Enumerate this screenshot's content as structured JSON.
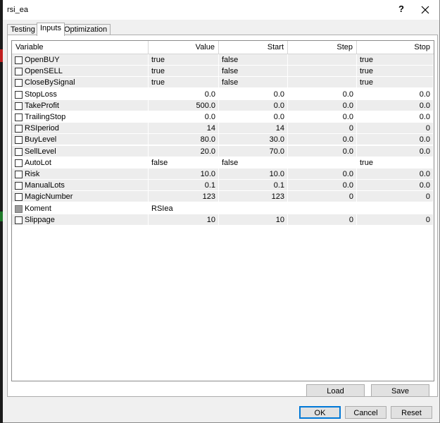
{
  "window": {
    "title": "rsi_ea",
    "help_glyph": "?"
  },
  "tabs": [
    {
      "label": "Testing"
    },
    {
      "label": "Inputs"
    },
    {
      "label": "Optimization"
    }
  ],
  "table": {
    "headers": [
      "Variable",
      "Value",
      "Start",
      "Step",
      "Stop"
    ],
    "rows": [
      {
        "name": "OpenBUY",
        "value": "true",
        "start": "false",
        "step": "",
        "stop": "true"
      },
      {
        "name": "OpenSELL",
        "value": "true",
        "start": "false",
        "step": "",
        "stop": "true"
      },
      {
        "name": "CloseBySignal",
        "value": "true",
        "start": "false",
        "step": "",
        "stop": "true"
      },
      {
        "name": "StopLoss",
        "value": "0.0",
        "start": "0.0",
        "step": "0.0",
        "stop": "0.0"
      },
      {
        "name": "TakeProfit",
        "value": "500.0",
        "start": "0.0",
        "step": "0.0",
        "stop": "0.0"
      },
      {
        "name": "TrailingStop",
        "value": "0.0",
        "start": "0.0",
        "step": "0.0",
        "stop": "0.0"
      },
      {
        "name": "RSIperiod",
        "value": "14",
        "start": "14",
        "step": "0",
        "stop": "0"
      },
      {
        "name": "BuyLevel",
        "value": "80.0",
        "start": "30.0",
        "step": "0.0",
        "stop": "0.0"
      },
      {
        "name": "SellLevel",
        "value": "20.0",
        "start": "70.0",
        "step": "0.0",
        "stop": "0.0"
      },
      {
        "name": "AutoLot",
        "value": "false",
        "start": "false",
        "step": "",
        "stop": "true"
      },
      {
        "name": "Risk",
        "value": "10.0",
        "start": "10.0",
        "step": "0.0",
        "stop": "0.0"
      },
      {
        "name": "ManualLots",
        "value": "0.1",
        "start": "0.1",
        "step": "0.0",
        "stop": "0.0"
      },
      {
        "name": "MagicNumber",
        "value": "123",
        "start": "123",
        "step": "0",
        "stop": "0"
      },
      {
        "name": "Koment",
        "value": "RSIea",
        "start": "",
        "step": "",
        "stop": ""
      },
      {
        "name": "Slippage",
        "value": "10",
        "start": "10",
        "step": "0",
        "stop": "0"
      }
    ]
  },
  "buttons": {
    "load": "Load",
    "save": "Save",
    "ok": "OK",
    "cancel": "Cancel",
    "reset": "Reset"
  }
}
